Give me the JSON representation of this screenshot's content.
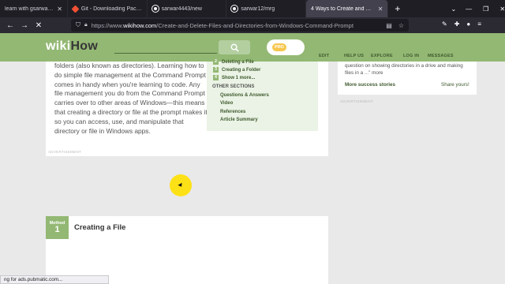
{
  "browser": {
    "tabs": [
      {
        "title": "learn with gsarwar - YouTube",
        "favicon": "youtube-icon",
        "active": false
      },
      {
        "title": "Git - Downloading Package",
        "favicon": "git-icon",
        "active": false
      },
      {
        "title": "sarwar4443/new",
        "favicon": "github-icon",
        "active": false
      },
      {
        "title": "sarwar12/mrg",
        "favicon": "github-icon",
        "active": false
      },
      {
        "title": "4 Ways to Create and Delete Fil",
        "favicon": "wikihow-icon",
        "active": true
      }
    ],
    "new_tab_label": "+",
    "url_prefix": "https://www.",
    "url_domain": "wikihow.com",
    "url_path": "/Create-and-Delete-Files-and-Directories-from-Windows-Command-Prompt",
    "status_text": "ng for ads.pubmatic.com..."
  },
  "wikihow": {
    "logo_wiki": "wiki",
    "logo_how": "How",
    "pro_label": "PRO",
    "nav": [
      "EDIT",
      "HELP US",
      "EXPLORE",
      "LOG IN",
      "MESSAGES"
    ],
    "intro_text": "folders (also known as directories). Learning how to do simple file management at the Command Prompt comes in handy when you're learning to code. Any file management you do from the Command Prompt carries over to other areas of Windows—this means that creating a directory or file at the prompt makes it so you can access, use, and manipulate that directory or file in Windows apps.",
    "toc": {
      "items": [
        {
          "num": "2",
          "label": "Deleting a File"
        },
        {
          "num": "3",
          "label": "Creating a Folder"
        },
        {
          "num": "4",
          "label": "Show 1 more..."
        }
      ],
      "other_heading": "OTHER SECTIONS",
      "other": [
        "Questions & Answers",
        "Video",
        "References",
        "Article Summary"
      ]
    },
    "advertisement_label": "ADVERTISEMENT",
    "sidebar": {
      "quote": "question on showing directories in a drive and making files in a ...\" more",
      "more_stories": "More success stories",
      "share": "Share yours!"
    },
    "method": {
      "label": "Method",
      "number": "1",
      "title": "Creating a File"
    }
  },
  "colors": {
    "brand_green": "#93b874",
    "link_green": "#3f5a2e",
    "cursor_highlight": "#ffe000"
  }
}
